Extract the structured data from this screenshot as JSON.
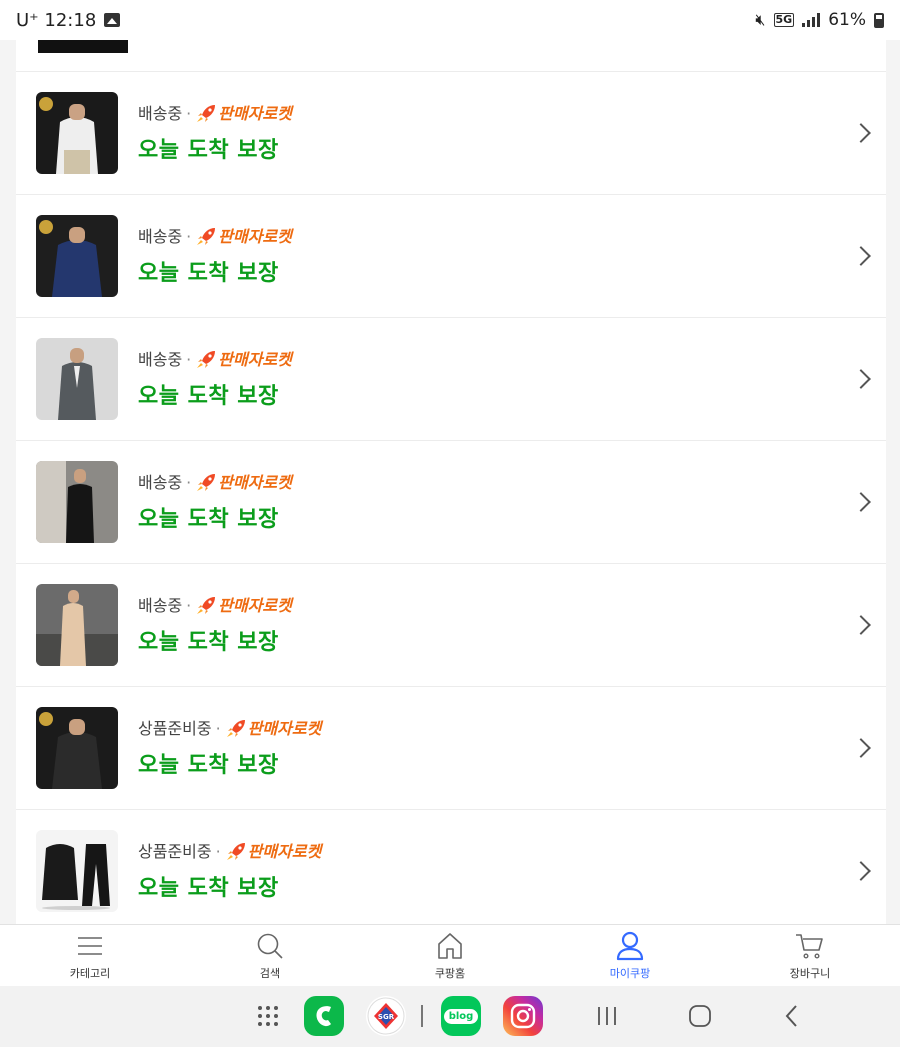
{
  "status_bar": {
    "carrier_time": "U⁺ 12:18",
    "network": "5G",
    "battery": "61%"
  },
  "orders": [
    {
      "status": "배송중",
      "rocket": "판매자로켓",
      "arrival": "오늘 도착 보장",
      "thumb": "white-shirt"
    },
    {
      "status": "배송중",
      "rocket": "판매자로켓",
      "arrival": "오늘 도착 보장",
      "thumb": "navy-shirt"
    },
    {
      "status": "배송중",
      "rocket": "판매자로켓",
      "arrival": "오늘 도착 보장",
      "thumb": "gray-suit"
    },
    {
      "status": "배송중",
      "rocket": "판매자로켓",
      "arrival": "오늘 도착 보장",
      "thumb": "black-setup"
    },
    {
      "status": "배송중",
      "rocket": "판매자로켓",
      "arrival": "오늘 도착 보장",
      "thumb": "beige-setup"
    },
    {
      "status": "상품준비중",
      "rocket": "판매자로켓",
      "arrival": "오늘 도착 보장",
      "thumb": "black-shirt"
    },
    {
      "status": "상품준비중",
      "rocket": "판매자로켓",
      "arrival": "오늘 도착 보장",
      "thumb": "black-tracksuit"
    }
  ],
  "bottom_nav": [
    {
      "label": "카테고리",
      "icon": "menu-icon"
    },
    {
      "label": "검색",
      "icon": "search-icon"
    },
    {
      "label": "쿠팡홈",
      "icon": "home-icon"
    },
    {
      "label": "마이쿠팡",
      "icon": "user-icon",
      "active": true
    },
    {
      "label": "장바구니",
      "icon": "cart-icon"
    }
  ],
  "dock": {
    "apps": [
      "app-drawer-icon",
      "phone-app-icon",
      "sgr-app-icon",
      "naver-blog-app-icon",
      "instagram-app-icon"
    ],
    "blog_label": "blog"
  },
  "colors": {
    "arrival_green": "#0b9d1b",
    "rocket_orange": "#ee6b11",
    "active_blue": "#346aff"
  }
}
